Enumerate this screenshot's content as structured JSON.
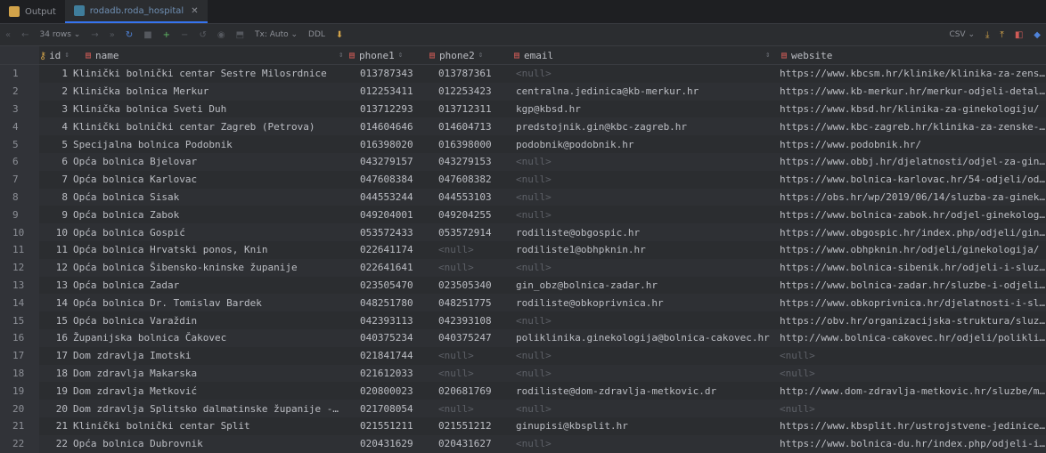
{
  "tabs": [
    {
      "label": "Output",
      "icon": "output-icon",
      "active": false
    },
    {
      "label": "rodadb.roda_hospital",
      "icon": "table-icon",
      "active": true
    }
  ],
  "toolbar": {
    "rows": "34 rows",
    "tx": "Tx: Auto",
    "ddl": "DDL",
    "export": "CSV"
  },
  "columns": [
    {
      "label": "id",
      "key": true
    },
    {
      "label": "name"
    },
    {
      "label": "phone1"
    },
    {
      "label": "phone2"
    },
    {
      "label": "email"
    },
    {
      "label": "website"
    }
  ],
  "rows": [
    {
      "rn": "1",
      "id": "1",
      "name": "Klinički bolnički centar Sestre Milosrdnice",
      "phone1": "013787343",
      "phone2": "013787361",
      "email": "<null>",
      "website": "https://www.kbcsm.hr/klinike/klinika-za-zens…"
    },
    {
      "rn": "2",
      "id": "2",
      "name": "Klinička bolnica Merkur",
      "phone1": "012253411",
      "phone2": "012253423",
      "email": "centralna.jedinica@kb-merkur.hr",
      "website": "https://www.kb-merkur.hr/merkur-odjeli-detal…"
    },
    {
      "rn": "3",
      "id": "3",
      "name": "Klinička bolnica Sveti Duh",
      "phone1": "013712293",
      "phone2": "013712311",
      "email": "kgp@kbsd.hr",
      "website": "https://www.kbsd.hr/klinika-za-ginekologiju/"
    },
    {
      "rn": "4",
      "id": "4",
      "name": "Klinički bolnički centar Zagreb (Petrova)",
      "phone1": "014604646",
      "phone2": "014604713",
      "email": "predstojnik.gin@kbc-zagreb.hr",
      "website": "https://www.kbc-zagreb.hr/klinika-za-zenske-…"
    },
    {
      "rn": "5",
      "id": "5",
      "name": "Specijalna bolnica Podobnik",
      "phone1": "016398020",
      "phone2": "016398000",
      "email": "podobnik@podobnik.hr",
      "website": "https://www.podobnik.hr/"
    },
    {
      "rn": "6",
      "id": "6",
      "name": "Opća bolnica Bjelovar",
      "phone1": "043279157",
      "phone2": "043279153",
      "email": "<null>",
      "website": "https://www.obbj.hr/djelatnosti/odjel-za-gin…"
    },
    {
      "rn": "7",
      "id": "7",
      "name": "Opća bolnica Karlovac",
      "phone1": "047608384",
      "phone2": "047608382",
      "email": "<null>",
      "website": "https://www.bolnica-karlovac.hr/54-odjeli/od…"
    },
    {
      "rn": "8",
      "id": "8",
      "name": "Opća bolnica Sisak",
      "phone1": "044553244",
      "phone2": "044553103",
      "email": "<null>",
      "website": "https://obs.hr/wp/2019/06/14/sluzba-za-ginek…"
    },
    {
      "rn": "9",
      "id": "9",
      "name": "Opća bolnica Zabok",
      "phone1": "049204001",
      "phone2": "049204255",
      "email": "<null>",
      "website": "https://www.bolnica-zabok.hr/odjel-ginekolog…"
    },
    {
      "rn": "10",
      "id": "10",
      "name": "Opća bolnica Gospić",
      "phone1": "053572433",
      "phone2": "053572914",
      "email": "rodiliste@obgospic.hr",
      "website": "https://www.obgospic.hr/index.php/odjeli/gin…"
    },
    {
      "rn": "11",
      "id": "11",
      "name": "Opća bolnica Hrvatski ponos, Knin",
      "phone1": "022641174",
      "phone2": "<null>",
      "email": "rodiliste1@obhpknin.hr",
      "website": "https://www.obhpknin.hr/odjeli/ginekologija/"
    },
    {
      "rn": "12",
      "id": "12",
      "name": "Opća bolnica Šibensko-kninske županije",
      "phone1": "022641641",
      "phone2": "<null>",
      "email": "<null>",
      "website": "https://www.bolnica-sibenik.hr/odjeli-i-sluz…"
    },
    {
      "rn": "13",
      "id": "13",
      "name": "Opća bolnica Zadar",
      "phone1": "023505470",
      "phone2": "023505340",
      "email": "gin_obz@bolnica-zadar.hr",
      "website": "https://www.bolnica-zadar.hr/sluzbe-i-odjeli…"
    },
    {
      "rn": "14",
      "id": "14",
      "name": "Opća bolnica Dr. Tomislav Bardek",
      "phone1": "048251780",
      "phone2": "048251775",
      "email": "rodiliste@obkoprivnica.hr",
      "website": "https://www.obkoprivnica.hr/djelatnosti-i-sl…"
    },
    {
      "rn": "15",
      "id": "15",
      "name": "Opća bolnica Varaždin",
      "phone1": "042393113",
      "phone2": "042393108",
      "email": "<null>",
      "website": "https://obv.hr/organizacijska-struktura/sluz…"
    },
    {
      "rn": "16",
      "id": "16",
      "name": "Županijska bolnica Čakovec",
      "phone1": "040375234",
      "phone2": "040375247",
      "email": "poliklinika.ginekologija@bolnica-cakovec.hr",
      "website": "http://www.bolnica-cakovec.hr/odjeli/polikli…"
    },
    {
      "rn": "17",
      "id": "17",
      "name": "Dom zdravlja Imotski",
      "phone1": "021841744",
      "phone2": "<null>",
      "email": "<null>",
      "website": "<null>"
    },
    {
      "rn": "18",
      "id": "18",
      "name": "Dom zdravlja Makarska",
      "phone1": "021612033",
      "phone2": "<null>",
      "email": "<null>",
      "website": "<null>"
    },
    {
      "rn": "19",
      "id": "19",
      "name": "Dom zdravlja Metković",
      "phone1": "020800023",
      "phone2": "020681769",
      "email": "rodiliste@dom-zdravlja-metkovic.dr",
      "website": "http://www.dom-zdravlja-metkovic.hr/sluzbe/m…"
    },
    {
      "rn": "20",
      "id": "20",
      "name": "Dom zdravlja Splitsko dalmatinske županije -…",
      "phone1": "021708054",
      "phone2": "<null>",
      "email": "<null>",
      "website": "<null>"
    },
    {
      "rn": "21",
      "id": "21",
      "name": "Klinički bolnički centar Split",
      "phone1": "021551211",
      "phone2": "021551212",
      "email": "ginupisi@kbsplit.hr",
      "website": "https://www.kbsplit.hr/ustrojstvene-jedinice…"
    },
    {
      "rn": "22",
      "id": "22",
      "name": "Opća bolnica Dubrovnik",
      "phone1": "020431629",
      "phone2": "020431627",
      "email": "<null>",
      "website": "https://www.bolnica-du.hr/index.php/odjeli-i…"
    }
  ]
}
